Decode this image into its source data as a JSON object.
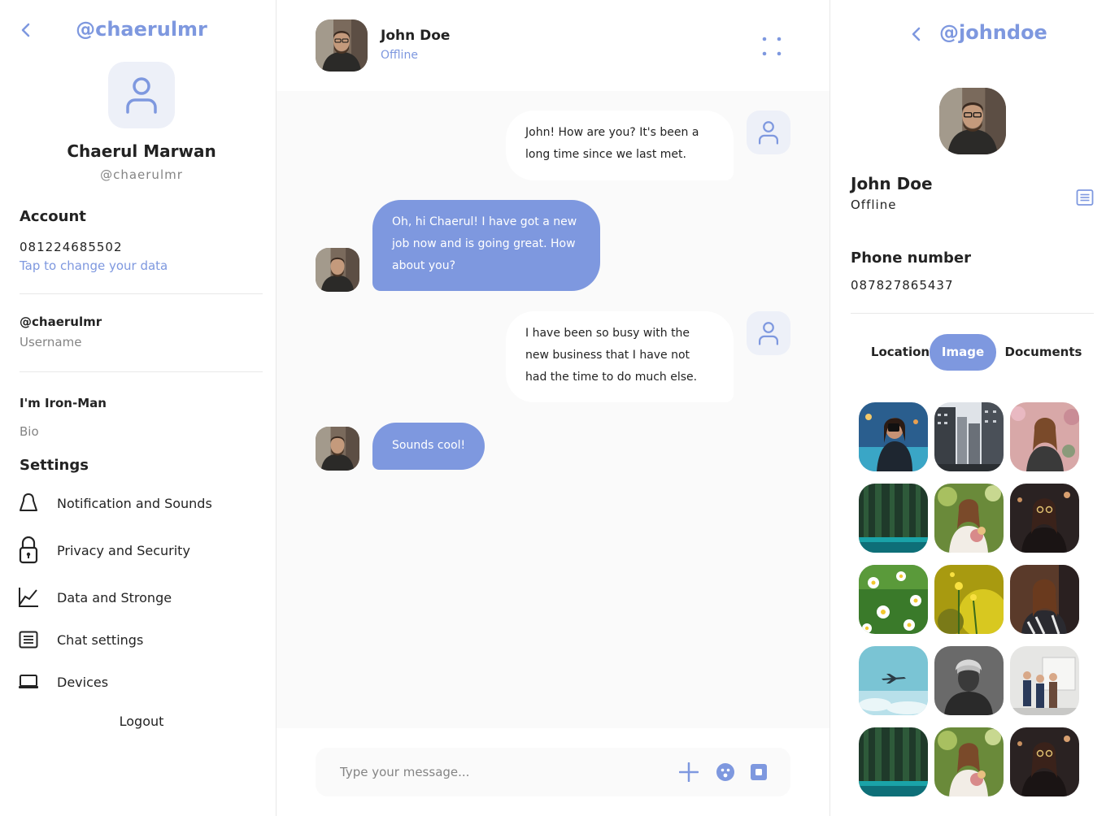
{
  "left_panel": {
    "handle": "@chaerulmr",
    "name": "Chaerul Marwan",
    "username": "@chaerulmr",
    "account": {
      "title": "Account",
      "phone": "081224685502",
      "change_link": "Tap to change your data"
    },
    "username_field": {
      "value": "@chaerulmr",
      "label": "Username"
    },
    "bio_field": {
      "value": "I'm Iron-Man",
      "label": "Bio"
    },
    "settings": {
      "title": "Settings",
      "items": [
        {
          "label": "Notification and Sounds",
          "icon": "bell-icon"
        },
        {
          "label": "Privacy and Security",
          "icon": "lock-icon"
        },
        {
          "label": "Data and Stronge",
          "icon": "chart-icon"
        },
        {
          "label": "Chat settings",
          "icon": "list-icon"
        },
        {
          "label": "Devices",
          "icon": "laptop-icon"
        }
      ]
    },
    "logout": "Logout"
  },
  "chat": {
    "contact_name": "John Doe",
    "contact_status": "Offline",
    "messages": [
      {
        "direction": "outgoing",
        "text": "John! How are you? It's been a long time since we last met."
      },
      {
        "direction": "incoming",
        "text": "Oh, hi Chaerul! I have got a new job now and is going great. How about you?"
      },
      {
        "direction": "outgoing",
        "text": "I have been so busy with the new business that I have not had the time to do much else."
      },
      {
        "direction": "incoming",
        "text": "Sounds cool!"
      }
    ],
    "composer": {
      "placeholder": "Type your message...",
      "icons": [
        "plus-icon",
        "emoji-icon",
        "camera-icon"
      ]
    }
  },
  "right_panel": {
    "handle": "@johndoe",
    "name": "John Doe",
    "status": "Offline",
    "phone_title": "Phone number",
    "phone": "087827865437",
    "tabs": [
      "Location",
      "Image",
      "Documents"
    ],
    "active_tab": "Image",
    "image_count": 15
  },
  "colors": {
    "accent": "#7e98df",
    "accent_light": "#edf0f8",
    "chat_background": "#fafafa",
    "text": "#232323",
    "muted": "#848484"
  }
}
